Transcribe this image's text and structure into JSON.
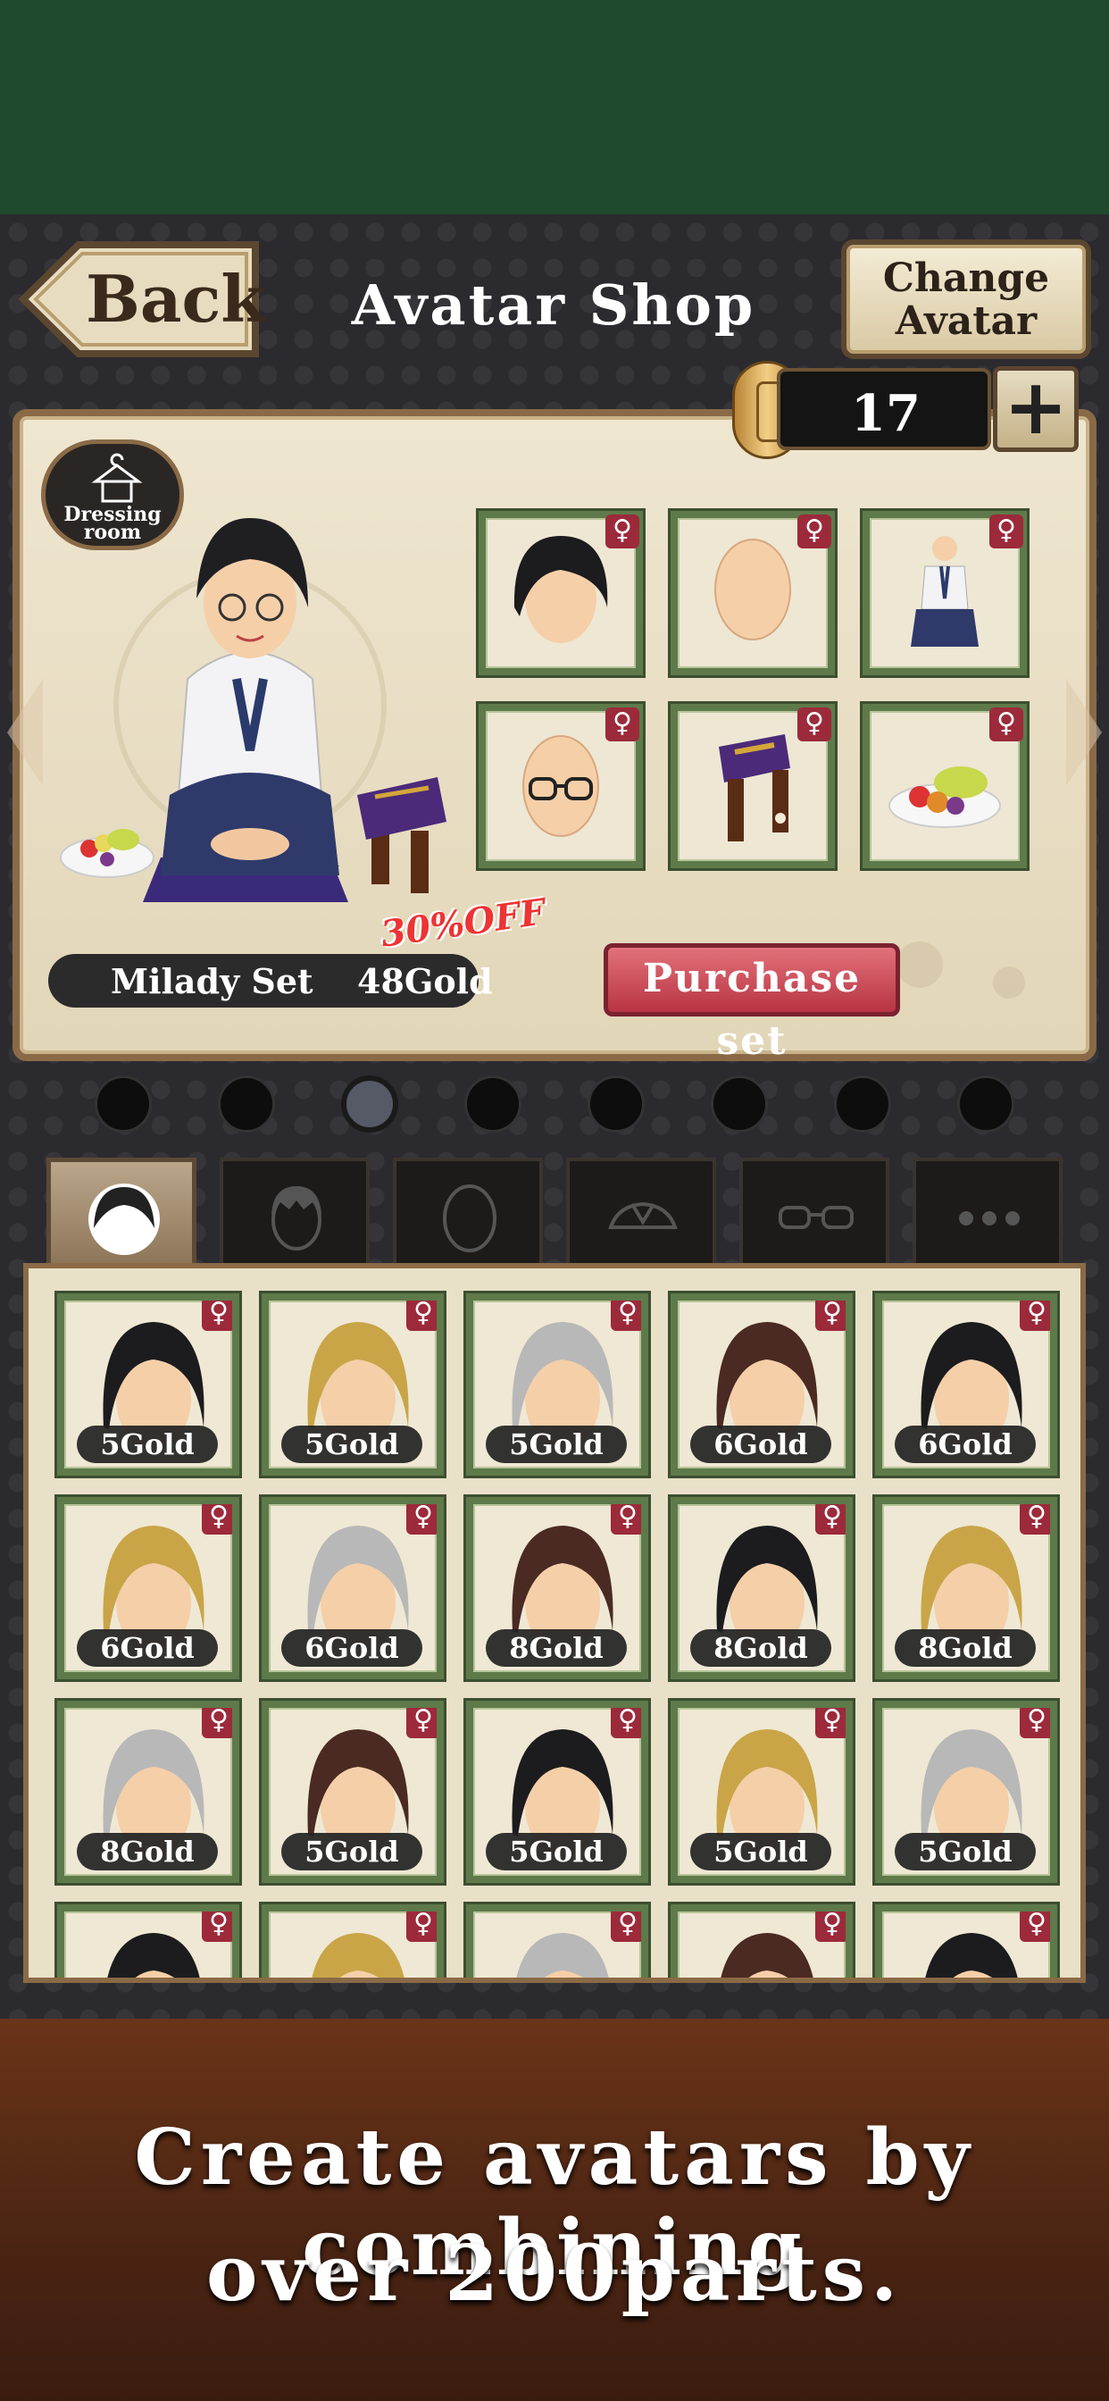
{
  "header": {
    "back_label": "Back",
    "title": "Avatar Shop",
    "change_line1": "Change",
    "change_line2": "Avatar"
  },
  "currency": {
    "amount": "17",
    "plus_label": "+"
  },
  "dressing_room": {
    "line1": "Dressing",
    "line2": "room"
  },
  "set": {
    "discount": "30%OFF",
    "name": "Milady Set",
    "price": "48Gold",
    "purchase_label": "Purchase set"
  },
  "set_items": [
    {
      "type": "hair-short-black",
      "gender": "♀"
    },
    {
      "type": "face-blank",
      "gender": "♀"
    },
    {
      "type": "outfit-hakama",
      "gender": "♀"
    },
    {
      "type": "face-glasses",
      "gender": "♀"
    },
    {
      "type": "stand-cushion",
      "gender": "♀"
    },
    {
      "type": "fruit-plate",
      "gender": "♀"
    }
  ],
  "pager": {
    "count": 8,
    "active": 3
  },
  "tabs": [
    "hair",
    "head",
    "face",
    "outfit",
    "glasses",
    "more"
  ],
  "parts": [
    {
      "color": "#1c1c1e",
      "price": "5Gold",
      "gender": "♀"
    },
    {
      "color": "#c9a548",
      "price": "5Gold",
      "gender": "♀"
    },
    {
      "color": "#b8b8b8",
      "price": "5Gold",
      "gender": "♀"
    },
    {
      "color": "#4a2a22",
      "price": "6Gold",
      "gender": "♀"
    },
    {
      "color": "#1c1c1e",
      "price": "6Gold",
      "gender": "♀"
    },
    {
      "color": "#c9a548",
      "price": "6Gold",
      "gender": "♀"
    },
    {
      "color": "#b8b8b8",
      "price": "6Gold",
      "gender": "♀"
    },
    {
      "color": "#4a2a22",
      "price": "8Gold",
      "gender": "♀"
    },
    {
      "color": "#1c1c1e",
      "price": "8Gold",
      "gender": "♀"
    },
    {
      "color": "#c9a548",
      "price": "8Gold",
      "gender": "♀"
    },
    {
      "color": "#b8b8b8",
      "price": "8Gold",
      "gender": "♀"
    },
    {
      "color": "#4a2a22",
      "price": "5Gold",
      "gender": "♀"
    },
    {
      "color": "#1c1c1e",
      "price": "5Gold",
      "gender": "♀"
    },
    {
      "color": "#c9a548",
      "price": "5Gold",
      "gender": "♀"
    },
    {
      "color": "#b8b8b8",
      "price": "5Gold",
      "gender": "♀"
    },
    {
      "color": "#1c1c1e",
      "price": "",
      "gender": "♀"
    },
    {
      "color": "#c9a548",
      "price": "",
      "gender": "♀"
    },
    {
      "color": "#b8b8b8",
      "price": "",
      "gender": "♀"
    },
    {
      "color": "#4a2a22",
      "price": "",
      "gender": "♀"
    },
    {
      "color": "#1c1c1e",
      "price": "",
      "gender": "♀"
    }
  ],
  "caption": {
    "line1": "Create avatars by combining",
    "line2": "over 200parts."
  }
}
